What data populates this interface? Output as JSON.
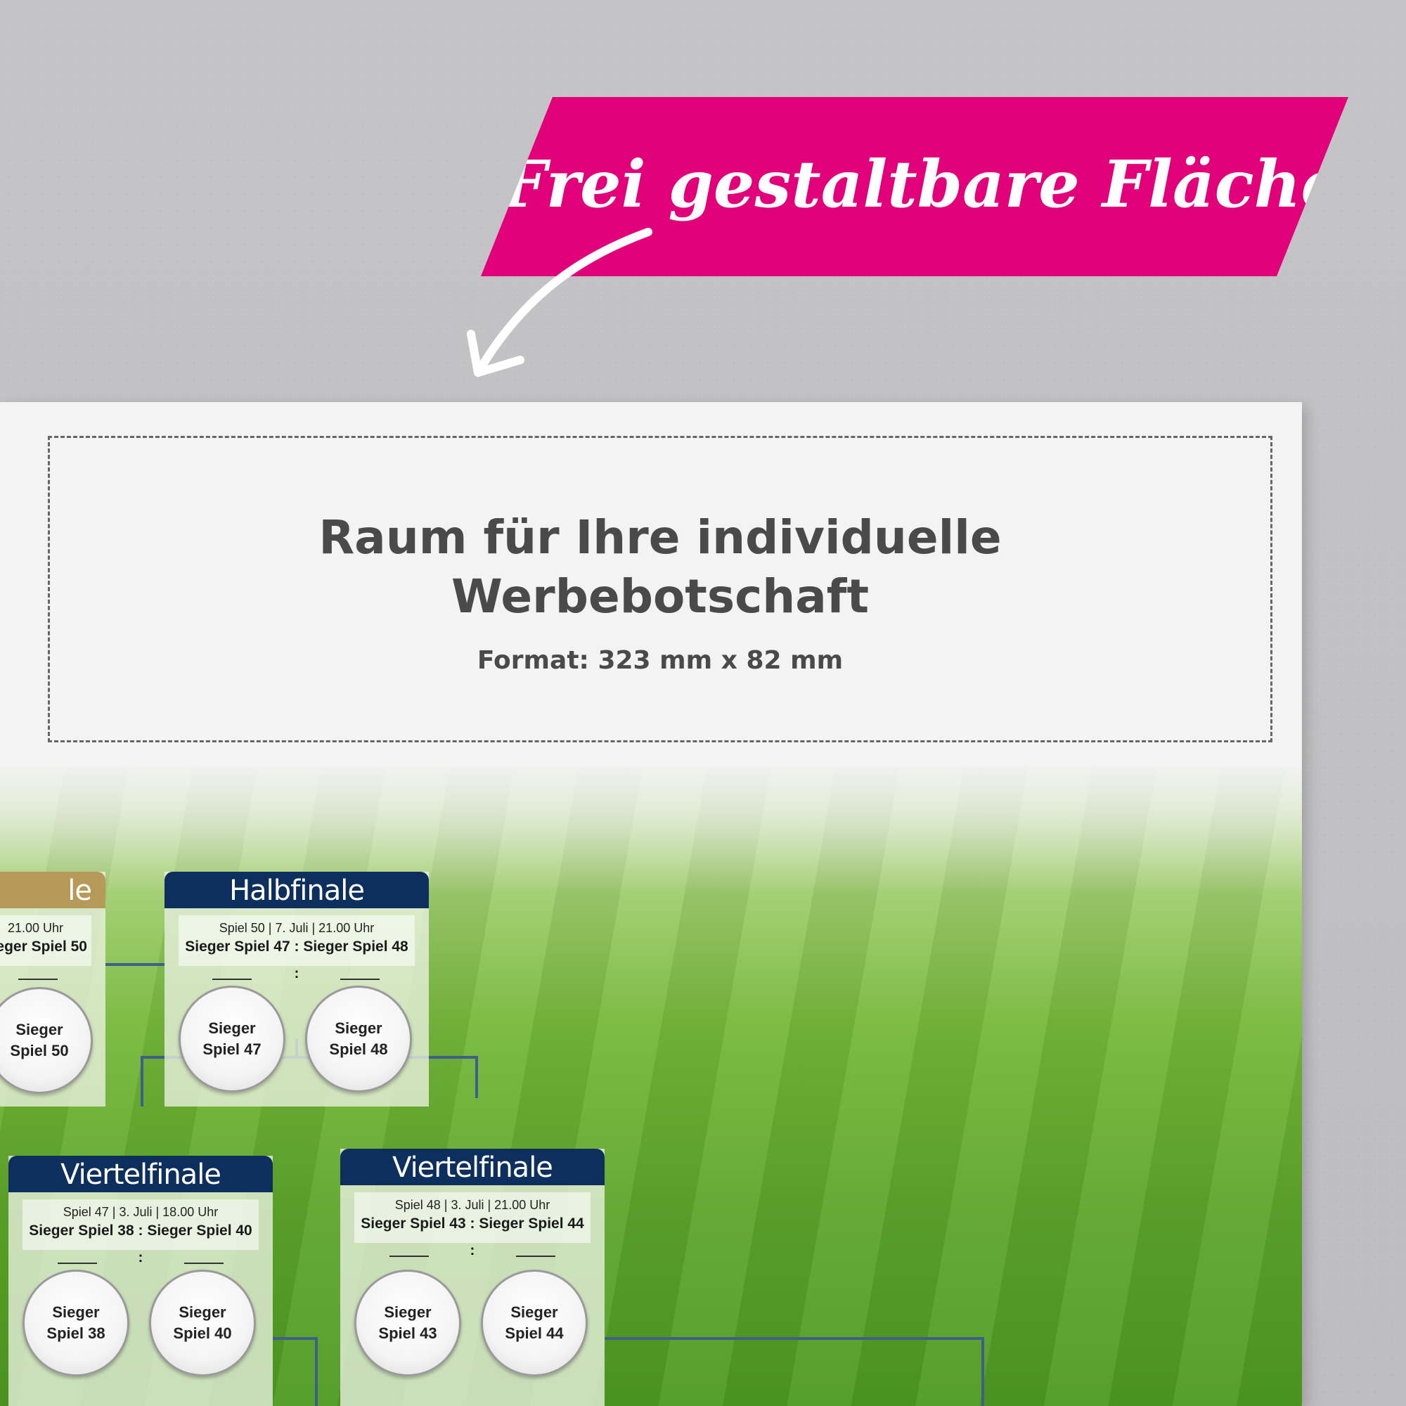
{
  "banner": {
    "text": "Frei gestaltbare Fläche"
  },
  "ad": {
    "headline_line1": "Raum für Ihre individuelle",
    "headline_line2": "Werbebotschaft",
    "format": "Format: 323 mm x 82 mm"
  },
  "cards": {
    "final_partial": {
      "title": "le",
      "meta": "21.00 Uhr",
      "pair": "eger Spiel 50",
      "team_b": [
        "Sieger",
        "Spiel 50"
      ]
    },
    "halbfinale": {
      "title": "Halbfinale",
      "meta": "Spiel 50 | 7. Juli | 21.00 Uhr",
      "pair": "Sieger Spiel 47 : Sieger Spiel 48",
      "colon": ":",
      "team_a": [
        "Sieger",
        "Spiel 47"
      ],
      "team_b": [
        "Sieger",
        "Spiel 48"
      ]
    },
    "viertelfinale_1": {
      "title": "Viertelfinale",
      "meta": "Spiel 47 | 3. Juli | 18.00 Uhr",
      "pair": "Sieger Spiel 38 : Sieger Spiel 40",
      "colon": ":",
      "team_a": [
        "Sieger",
        "Spiel 38"
      ],
      "team_b": [
        "Sieger",
        "Spiel 40"
      ]
    },
    "viertelfinale_2": {
      "title": "Viertelfinale",
      "meta": "Spiel 48 | 3. Juli | 21.00 Uhr",
      "pair": "Sieger Spiel 43 : Sieger Spiel 44",
      "colon": ":",
      "team_a": [
        "Sieger",
        "Spiel 43"
      ],
      "team_b": [
        "Sieger",
        "Spiel 44"
      ]
    }
  },
  "colors": {
    "banner": "#e2007a",
    "card_header": "#0d2f5e",
    "final_header": "#b69a5a",
    "grass": "#5da52b",
    "poster_bg": "#f3f3f3",
    "wall": "#c4c4c6"
  },
  "icons": {
    "arrow": "curved-arrow-icon"
  }
}
